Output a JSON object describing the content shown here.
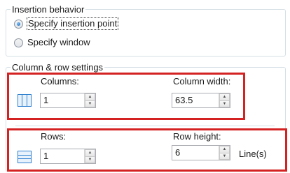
{
  "insertion": {
    "title": "Insertion behavior",
    "options": [
      {
        "label": "Specify insertion point",
        "checked": true
      },
      {
        "label": "Specify window",
        "checked": false
      }
    ]
  },
  "settings": {
    "title": "Column & row settings",
    "columns": {
      "label": "Columns:",
      "value": "1",
      "icon": "columns-icon"
    },
    "column_width": {
      "label": "Column width:",
      "value": "63.5"
    },
    "rows": {
      "label": "Rows:",
      "value": "1",
      "icon": "rows-icon"
    },
    "row_height": {
      "label": "Row height:",
      "value": "6",
      "unit": "Line(s)"
    }
  },
  "colors": {
    "highlight": "#d42222",
    "icon_accent": "#2d7fd0"
  }
}
